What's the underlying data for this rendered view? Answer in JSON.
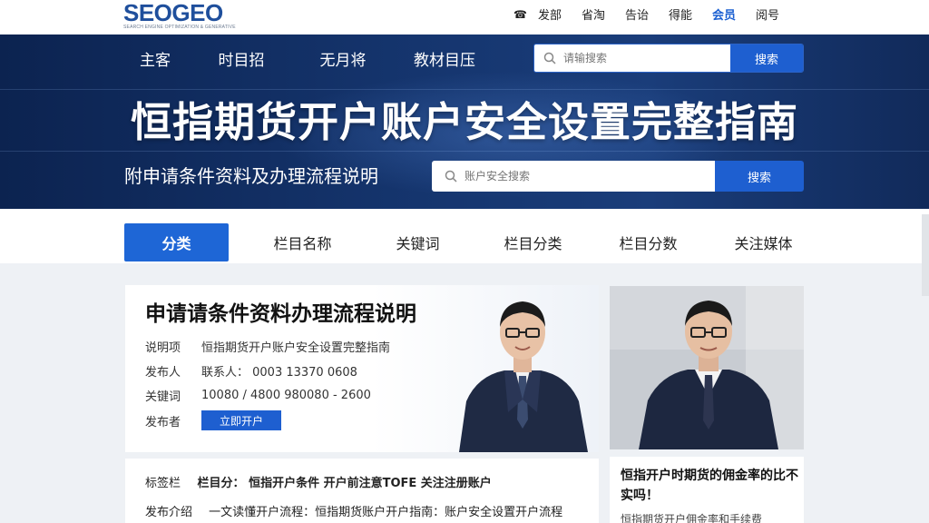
{
  "logo": {
    "main": "SEOGEO",
    "tagline": "SEARCH ENGINE OPTIMIZATION & GENERATIVE"
  },
  "top_links": [
    "发部",
    "省淘",
    "告诒",
    "得能",
    "会员",
    "阅号"
  ],
  "top_icon": "phone-icon",
  "nav": [
    "主客",
    "时目招",
    "无月将",
    "教材目压"
  ],
  "search_top": {
    "placeholder": "请输搜索",
    "button": "搜索"
  },
  "hero": {
    "title": "恒指期货开户账户安全设置完整指南",
    "subtitle": "附申请条件资料及办理流程说明"
  },
  "search_hero": {
    "placeholder": "账户安全搜索",
    "button": "搜索"
  },
  "tabs": [
    "分类",
    "栏目名称",
    "关键词",
    "栏目分类",
    "栏目分数",
    "关注媒体"
  ],
  "article": {
    "title": "申请请条件资料办理流程说明",
    "rows": [
      {
        "label": "说明项",
        "value": "恒指期货开户账户安全设置完整指南"
      },
      {
        "label": "发布人",
        "value": "联系人：  0003   13370   0608"
      },
      {
        "label": "关键词",
        "value": "10080 / 4800  980080 - 2600"
      },
      {
        "label": "发布者",
        "value": ""
      }
    ],
    "button": "立即开户"
  },
  "card3": {
    "row1": {
      "label": "标签栏",
      "text": "栏目分：  恒指开户条件  开户前注意TOFE  关注注册账户"
    },
    "row2": {
      "label": "发布介绍",
      "text": "一文读懂开户流程：恒指期货账户开户指南：账户安全设置开户流程"
    }
  },
  "card4": {
    "title": "恒指开户时期货的佣金率的比不实吗！",
    "sub": "恒指期货开户佣金率和手续费"
  },
  "colors": {
    "navy": "#0c2350",
    "accent": "#1e5fd0",
    "logo": "#1f4f9c"
  }
}
